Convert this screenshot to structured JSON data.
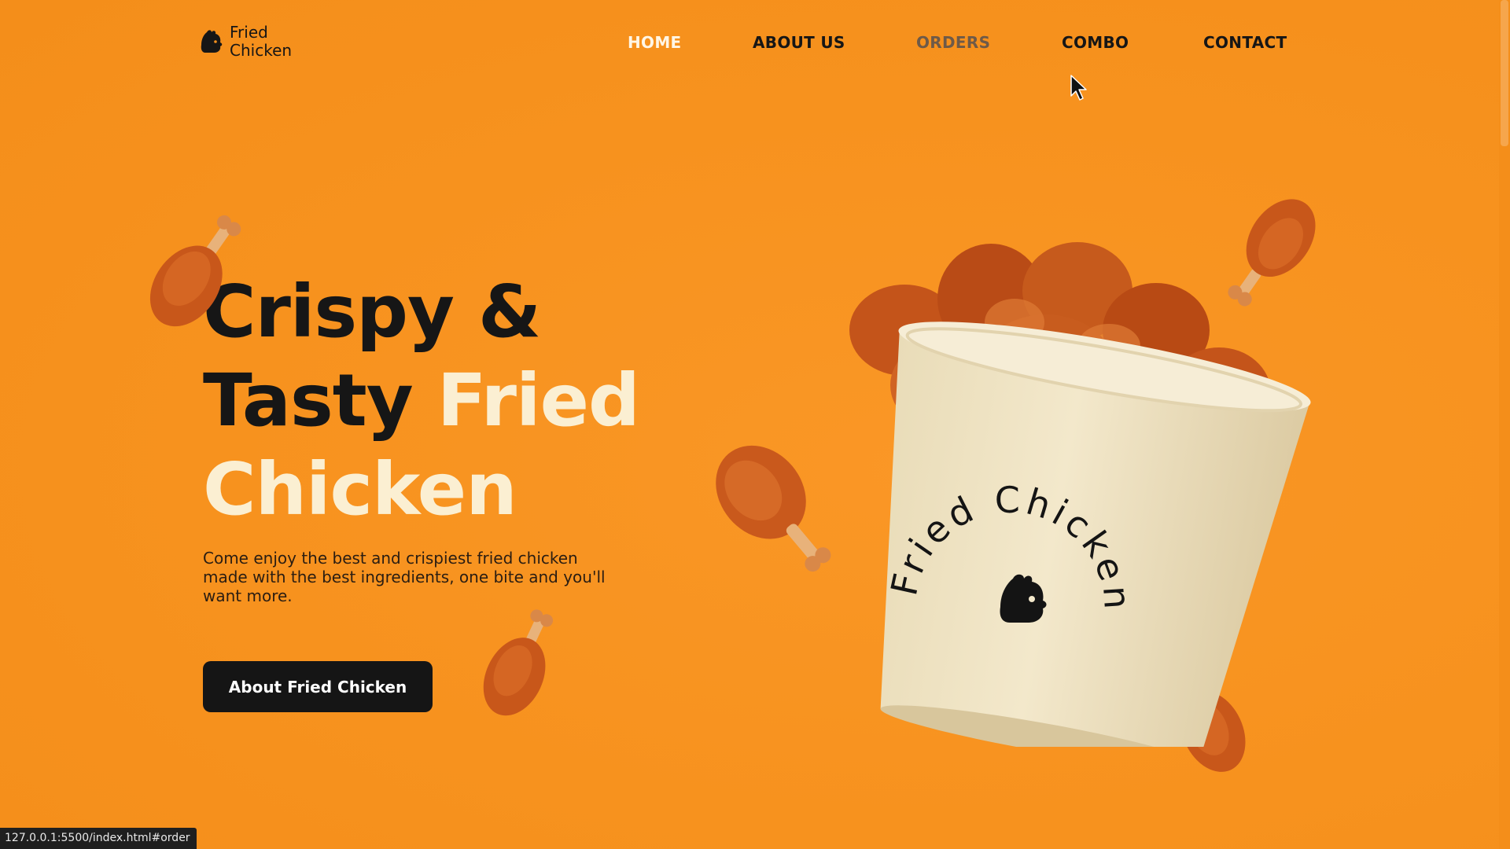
{
  "brand": {
    "logo_line1": "Fried",
    "logo_line2": "Chicken",
    "icon": "chicken-head-icon"
  },
  "nav": {
    "items": [
      {
        "label": "HOME",
        "state": "active"
      },
      {
        "label": "ABOUT US",
        "state": "default"
      },
      {
        "label": "ORDERS",
        "state": "hover"
      },
      {
        "label": "COMBO",
        "state": "default"
      },
      {
        "label": "CONTACT",
        "state": "default"
      }
    ]
  },
  "hero": {
    "title_dark_1": "Crispy &",
    "title_dark_2": "Tasty",
    "title_light_1": "Fried",
    "title_light_2": "Chicken",
    "description": "Come enjoy the best and crispiest fried chicken made with the best ingredients, one bite and you'll want more.",
    "cta_label": "About Fried Chicken"
  },
  "bucket": {
    "printed_text": "Fried Chicken",
    "icon": "chicken-head-icon"
  },
  "status_bar": {
    "url": "127.0.0.1:5500/index.html#order"
  },
  "colors": {
    "background": "#F7921E",
    "accent_light": "#FBEFD2",
    "text_dark": "#161616",
    "button_bg": "#151515",
    "nav_active": "#FFF6E6",
    "nav_hover": "#6E5A48"
  }
}
